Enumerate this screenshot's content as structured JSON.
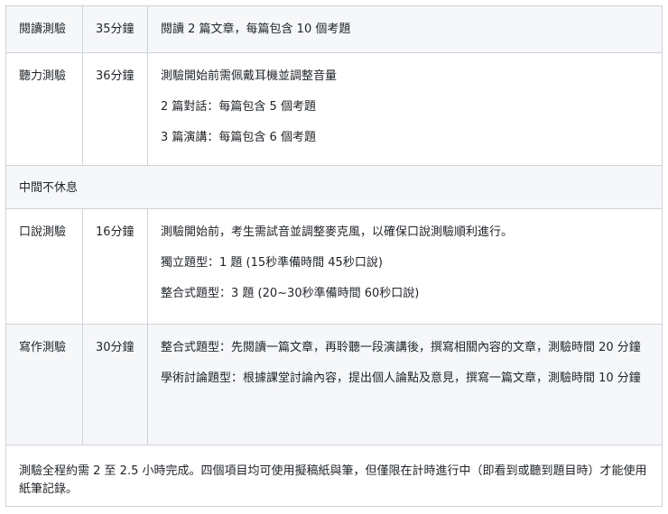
{
  "rows": [
    {
      "section": "閱讀測驗",
      "time": "35分鐘",
      "details": [
        "閱讀 2 篇文章，每篇包含 10 個考題"
      ]
    },
    {
      "section": "聽力測驗",
      "time": "36分鐘",
      "details": [
        "測驗開始前需佩戴耳機並調整音量",
        "2 篇對話：每篇包含 5 個考題",
        "3 篇演講：每篇包含 6 個考題"
      ]
    },
    {
      "break_note": "中間不休息"
    },
    {
      "section": "口說測驗",
      "time": "16分鐘",
      "details": [
        "測驗開始前，考生需試音並調整麥克風，以確保口說測驗順利進行。",
        "獨立題型：1 題 (15秒準備時間 45秒口說)",
        "整合式題型：3 題 (20~30秒準備時間 60秒口說)"
      ]
    },
    {
      "section": "寫作測驗",
      "time": "30分鐘",
      "details": [
        "整合式題型：先閱讀一篇文章，再聆聽一段演講後，撰寫相關內容的文章，測驗時間 20 分鐘",
        "學術討論題型：根據課堂討論內容，提出個人論點及意見，撰寫一篇文章，測驗時間 10 分鐘"
      ]
    },
    {
      "footer_note": "測驗全程約需 2 至 2.5 小時完成。四個項目均可使用擬稿紙與筆，但僅限在計時進行中（即看到或聽到題目時）才能使用紙筆記錄。"
    }
  ]
}
